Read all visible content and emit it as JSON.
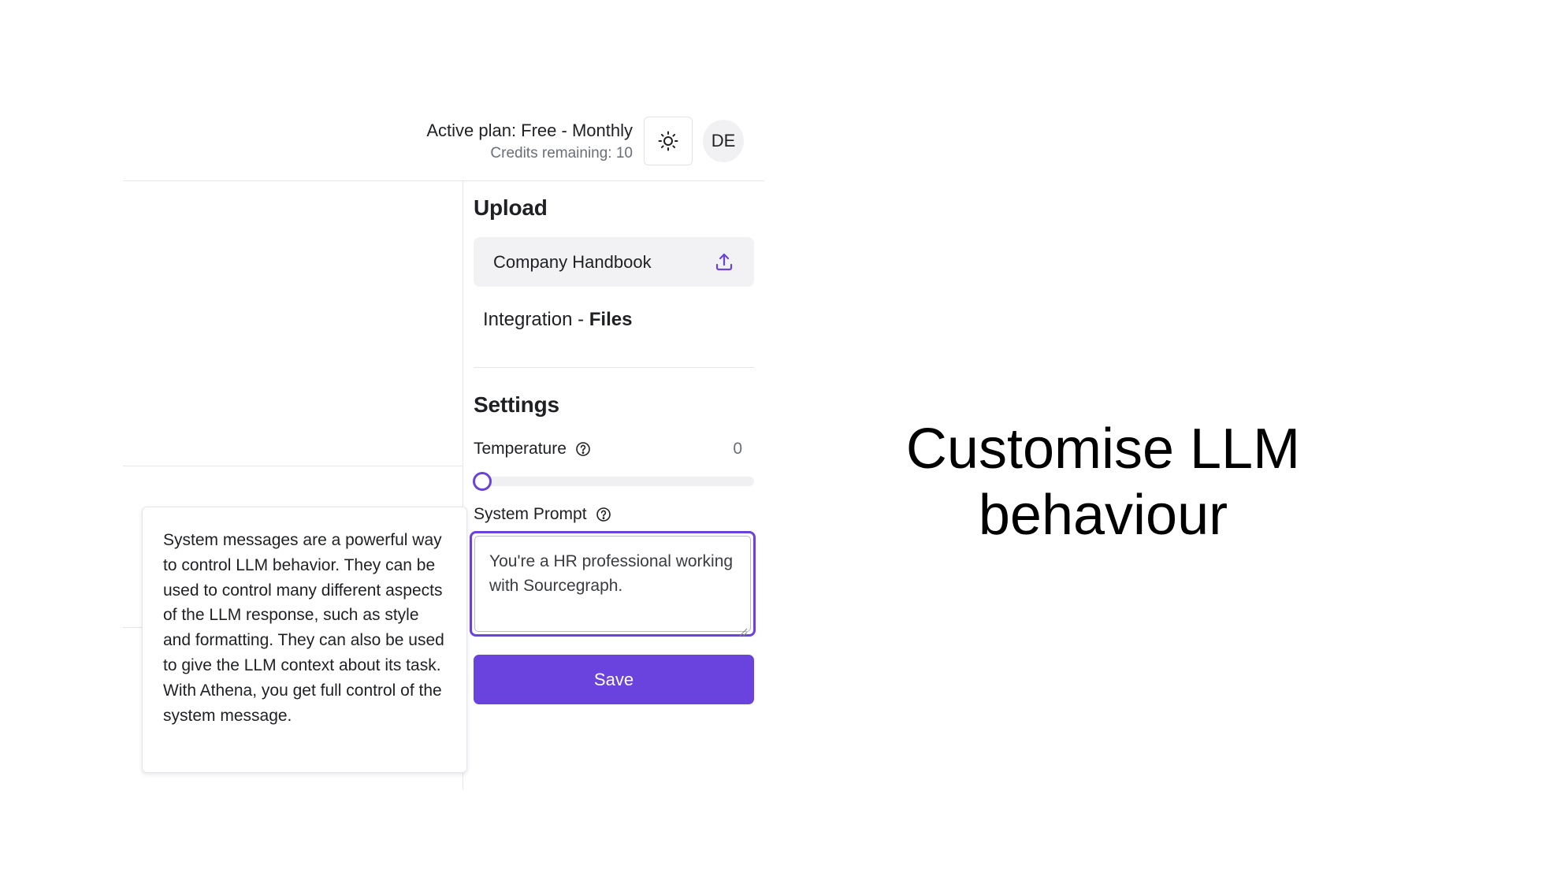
{
  "header": {
    "plan_title": "Active plan: Free - Monthly",
    "credits": "Credits remaining: 10",
    "theme_icon": "sun-icon",
    "avatar_initials": "DE"
  },
  "upload": {
    "title": "Upload",
    "card_label": "Company Handbook",
    "card_icon": "upload-icon",
    "integration_prefix": "Integration - ",
    "integration_bold": "Files"
  },
  "settings": {
    "title": "Settings",
    "temperature_label": "Temperature",
    "temperature_value": "0",
    "temperature_slider_fraction": 0,
    "system_prompt_label": "System Prompt",
    "system_prompt_value": "You're a HR professional working with Sourcegraph.",
    "help_icon": "question-circle-icon",
    "save_label": "Save"
  },
  "tooltip": {
    "text": "System messages are a powerful way to control LLM behavior. They can be used to control many different aspects of the LLM response, such as style and formatting. They can also be used to give the LLM context about its task. With Athena, you get full control of the system message."
  },
  "headline": {
    "line1": "Customise LLM",
    "line2": "behaviour"
  },
  "colors": {
    "accent": "#6a42dd",
    "card_bg": "#f2f2f4",
    "text": "#1f2024",
    "muted": "#6b6e76"
  }
}
